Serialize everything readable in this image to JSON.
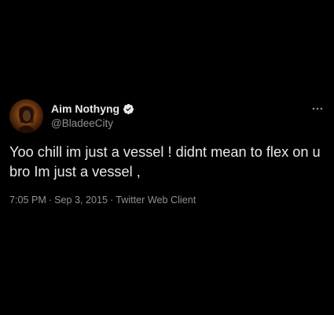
{
  "tweet": {
    "display_name": "Aim Nothyng",
    "handle": "@BladeeCity",
    "text": "Yoo chill im just a vessel ! didnt mean to flex on u bro Im just a vessel ,",
    "time": "7:05 PM",
    "date": "Sep 3, 2015",
    "client": "Twitter Web Client",
    "separator": "·",
    "verified_icon": "verified-badge-icon",
    "more_icon": "more-horizontal-icon"
  },
  "colors": {
    "background": "#000000",
    "text_primary": "#e7e9ea",
    "text_secondary": "#8b9197",
    "verified_badge": "#e7e9ea"
  }
}
